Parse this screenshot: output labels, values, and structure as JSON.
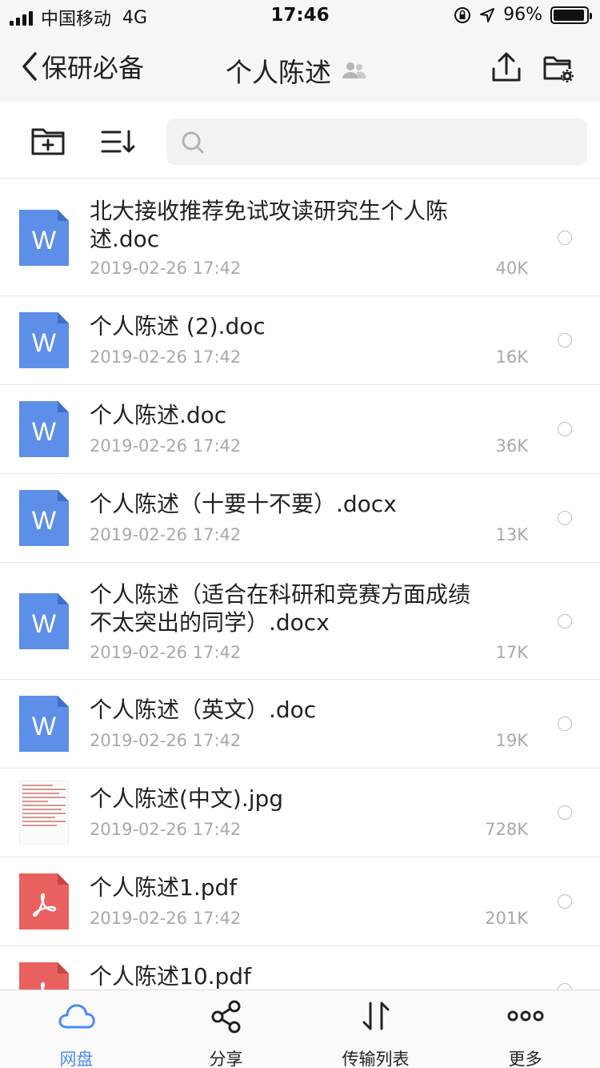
{
  "status_bar": {
    "carrier": "中国移动",
    "network": "4G",
    "time": "17:46",
    "battery": "96%",
    "battery_level": 0.96
  },
  "nav": {
    "back_label": "保研必备",
    "title": "个人陈述"
  },
  "search": {
    "placeholder": ""
  },
  "files": [
    {
      "name": "北大接收推荐免试攻读研究生个人陈述.doc",
      "date": "2019-02-26 17:42",
      "size": "40K",
      "type": "word"
    },
    {
      "name": "个人陈述 (2).doc",
      "date": "2019-02-26 17:42",
      "size": "16K",
      "type": "word"
    },
    {
      "name": "个人陈述.doc",
      "date": "2019-02-26 17:42",
      "size": "36K",
      "type": "word"
    },
    {
      "name": "个人陈述（十要十不要）.docx",
      "date": "2019-02-26 17:42",
      "size": "13K",
      "type": "word"
    },
    {
      "name": "个人陈述（适合在科研和竞赛方面成绩不太突出的同学）.docx",
      "date": "2019-02-26 17:42",
      "size": "17K",
      "type": "word"
    },
    {
      "name": "个人陈述（英文）.doc",
      "date": "2019-02-26 17:42",
      "size": "19K",
      "type": "word"
    },
    {
      "name": "个人陈述(中文).jpg",
      "date": "2019-02-26 17:42",
      "size": "728K",
      "type": "image"
    },
    {
      "name": "个人陈述1.pdf",
      "date": "2019-02-26 17:42",
      "size": "201K",
      "type": "pdf"
    },
    {
      "name": "个人陈述10.pdf",
      "date": "",
      "size": "",
      "type": "pdf"
    }
  ],
  "icons": {
    "word_letter": "W"
  },
  "tabs": [
    {
      "label": "网盘",
      "icon": "cloud-icon",
      "active": true
    },
    {
      "label": "分享",
      "icon": "share-icon",
      "active": false
    },
    {
      "label": "传输列表",
      "icon": "transfer-icon",
      "active": false
    },
    {
      "label": "更多",
      "icon": "more-icon",
      "active": false
    }
  ],
  "colors": {
    "accent": "#4b8cf5",
    "word": "#5d8fe8",
    "pdf": "#e9615e",
    "secondary_text": "#a8a8a8"
  }
}
